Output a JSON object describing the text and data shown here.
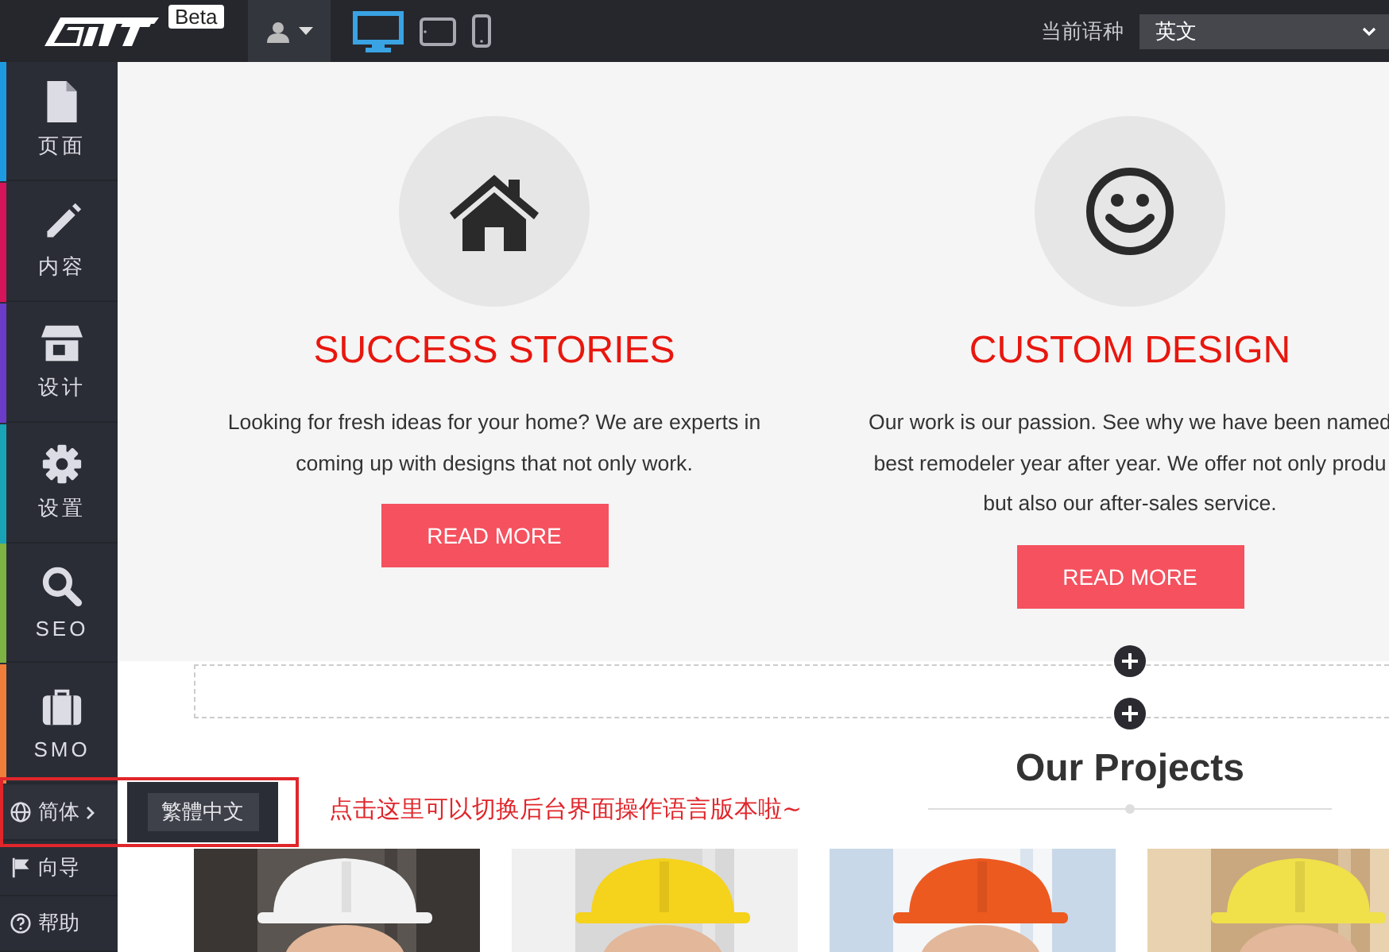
{
  "topbar": {
    "beta_badge": "Beta",
    "devices": [
      {
        "kind": "desktop",
        "selected": true
      },
      {
        "kind": "tablet",
        "selected": false
      },
      {
        "kind": "phone",
        "selected": false
      }
    ],
    "language_label": "当前语种",
    "language_select": {
      "value": "英文"
    }
  },
  "sidebar": {
    "items": [
      {
        "kind": "page",
        "label": "页面",
        "color": "#1e9be0"
      },
      {
        "kind": "pencil",
        "label": "内容",
        "color": "#d6145a"
      },
      {
        "kind": "store",
        "label": "设计",
        "color": "#6a3cc8"
      },
      {
        "kind": "gear",
        "label": "设置",
        "color": "#19a3b6"
      },
      {
        "kind": "search",
        "label": "SEO",
        "color": "#7cb342"
      },
      {
        "kind": "briefcase",
        "label": "SMO",
        "color": "#f07e3a"
      }
    ],
    "links": [
      {
        "kind": "globe",
        "label": "简体",
        "expanded": true
      },
      {
        "kind": "flag",
        "label": "向导",
        "expanded": false
      },
      {
        "kind": "help",
        "label": "帮助",
        "expanded": false
      }
    ]
  },
  "language_popup": {
    "option": "繁體中文"
  },
  "annotation": "点击这里可以切换后台界面操作语言版本啦~",
  "features": [
    {
      "kind": "house",
      "title": "SUCCESS STORIES",
      "lines": [
        "Looking for fresh ideas for your home? We are experts in",
        "coming up with designs that not only work."
      ],
      "button": "READ MORE"
    },
    {
      "kind": "smiley",
      "title": "CUSTOM DESIGN",
      "lines": [
        "Our work is our passion. See why we have been named",
        "best remodeler year after year. We offer not only produ",
        "but also our after-sales service."
      ],
      "button": "READ MORE"
    }
  ],
  "projects": {
    "title": "Our Projects"
  }
}
